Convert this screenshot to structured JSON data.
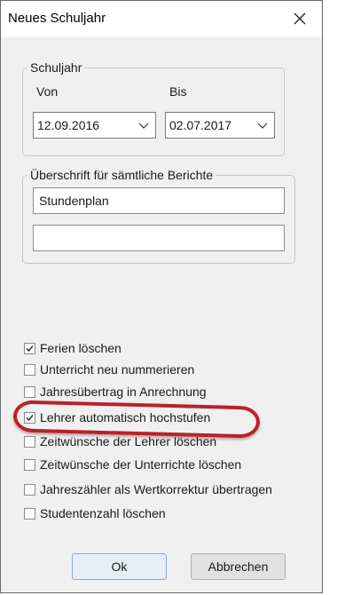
{
  "window": {
    "title": "Neues Schuljahr",
    "close_icon": "close-icon"
  },
  "schuljahr": {
    "legend": "Schuljahr",
    "von_label": "Von",
    "bis_label": "Bis",
    "von_value": "12.09.2016",
    "bis_value": "02.07.2017"
  },
  "ueberschrift": {
    "legend": "Überschrift für sämtliche Berichte",
    "line1": "Stundenplan",
    "line2": ""
  },
  "options": [
    {
      "label": "Ferien löschen",
      "checked": true
    },
    {
      "label": "Unterricht neu nummerieren",
      "checked": false
    },
    {
      "label": "Jahresübertrag in Anrechnung",
      "checked": false
    },
    {
      "label": "Lehrer automatisch hochstufen",
      "checked": true
    },
    {
      "label": "Zeitwünsche der Lehrer löschen",
      "checked": false
    },
    {
      "label": "Zeitwünsche der Unterrichte löschen",
      "checked": false
    },
    {
      "label": "Jahreszähler als Wertkorrektur übertragen",
      "checked": false
    },
    {
      "label": "Studentenzahl löschen",
      "checked": false
    }
  ],
  "buttons": {
    "ok": "Ok",
    "cancel": "Abbrechen"
  },
  "colors": {
    "highlight": "#b8222a",
    "window_bg": "#f0f0f0"
  }
}
